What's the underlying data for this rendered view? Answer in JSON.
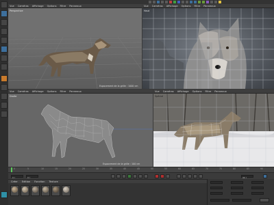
{
  "toolbar_top": {
    "icons": [
      "undo-icon",
      "redo-icon",
      "move-icon",
      "scale-icon",
      "rotate-icon",
      "select-icon",
      "axis-x-icon",
      "axis-y-icon",
      "axis-z-icon",
      "world-icon",
      "render-view-icon",
      "render-icon",
      "render-settings-icon",
      "cube-icon",
      "pen-icon",
      "subdivide-icon",
      "array-icon",
      "deformer-icon",
      "scene-icon",
      "camera-icon",
      "light-icon"
    ]
  },
  "viewports": {
    "top_left": {
      "menu": [
        "Vue",
        "Caméras",
        "Affichage",
        "Options",
        "Filtre",
        "Panneaux"
      ],
      "title": "Perspective",
      "caption": "Espacement de la grille : 1000 cm"
    },
    "top_right": {
      "menu": [
        "Vue",
        "Caméras",
        "Affichage",
        "Options",
        "Filtre",
        "Panneaux"
      ],
      "title": "Haut"
    },
    "bottom_left": {
      "menu": [
        "Vue",
        "Caméras",
        "Affichage",
        "Options",
        "Filtre",
        "Panneaux"
      ],
      "title": "Droite",
      "caption": "Espacement de la grille : 100 cm"
    },
    "bottom_right": {
      "menu": [
        "Vue",
        "Caméras",
        "Affichage",
        "Options",
        "Filtre",
        "Panneaux"
      ],
      "title": "Spécial"
    }
  },
  "timeline": {
    "ticks": [
      "0",
      "5",
      "10",
      "15",
      "20",
      "25",
      "30",
      "35",
      "40",
      "45",
      "50",
      "55",
      "60",
      "65",
      "70",
      "75",
      "80",
      "85",
      "90"
    ],
    "current_frame": "0 I",
    "start_field": "0 I",
    "end_field": "90 I"
  },
  "materials": {
    "menu": [
      "Créer",
      "Edition",
      "Fonction",
      "Texture"
    ],
    "count": 6
  },
  "colors": {
    "bg": "#3a3a3a",
    "accent_blue": "#3d6f9c",
    "accent_orange": "#c87a2c",
    "play_green": "#5ac85a"
  }
}
